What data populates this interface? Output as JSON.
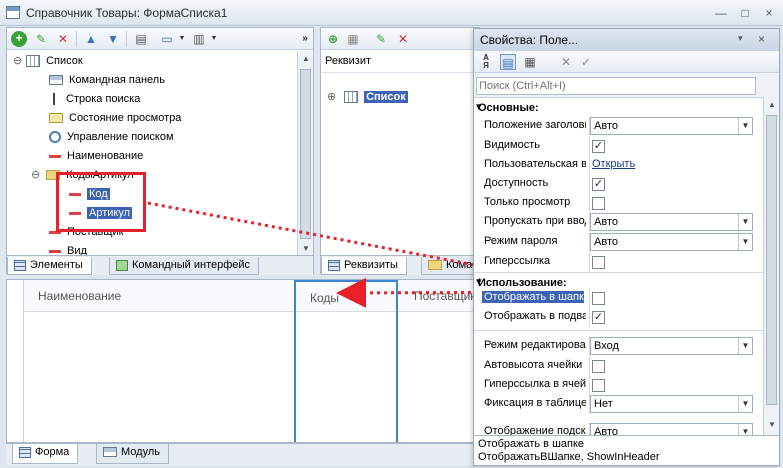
{
  "window": {
    "title": "Справочник Товары: ФормаСписка1",
    "minimize_glyph": "—",
    "maximize_glyph": "□",
    "close_glyph": "×"
  },
  "elements_tree": {
    "items": [
      {
        "label": "Список",
        "icon": "table-icon"
      },
      {
        "label": "Командная панель",
        "icon": "command-panel-icon"
      },
      {
        "label": "Строка поиска",
        "icon": "search-line-icon"
      },
      {
        "label": "Состояние просмотра",
        "icon": "view-state-icon"
      },
      {
        "label": "Управление поиском",
        "icon": "search-control-icon"
      },
      {
        "label": "Наименование",
        "icon": "field-icon"
      },
      {
        "label": "КодыАртикул",
        "icon": "folder-icon"
      },
      {
        "label": "Код",
        "icon": "field-icon"
      },
      {
        "label": "Артикул",
        "icon": "field-icon"
      },
      {
        "label": "Поставщик",
        "icon": "field-icon"
      },
      {
        "label": "Вид",
        "icon": "field-icon"
      }
    ]
  },
  "left_tabs": [
    "Элементы",
    "Командный интерфейс"
  ],
  "requisites": {
    "header": "Реквизит",
    "items": [
      {
        "label": "Список",
        "icon": "table-icon"
      }
    ],
    "tabs": [
      "Реквизиты",
      "Команды"
    ]
  },
  "preview": {
    "columns": [
      "Наименование",
      "Коды",
      "Поставщик"
    ]
  },
  "bottom_tabs": [
    "Форма",
    "Модуль"
  ],
  "properties": {
    "title": "Свойства: Поле...",
    "search_placeholder": "Поиск (Ctrl+Alt+I)",
    "sections": [
      "Основные:",
      "Использование:"
    ],
    "rows": [
      {
        "label": "Положение заголовка",
        "type": "combo",
        "value": "Авто"
      },
      {
        "label": "Видимость",
        "type": "check",
        "value": "✓"
      },
      {
        "label": "Пользовательская видимость",
        "type": "link",
        "value": "Открыть"
      },
      {
        "label": "Доступность",
        "type": "check",
        "value": "✓"
      },
      {
        "label": "Только просмотр",
        "type": "check",
        "value": ""
      },
      {
        "label": "Пропускать при вводе",
        "type": "combo",
        "value": "Авто"
      },
      {
        "label": "Режим пароля",
        "type": "combo",
        "value": "Авто"
      },
      {
        "label": "Гиперссылка",
        "type": "check",
        "value": ""
      },
      {
        "label": "Отображать в шапке",
        "type": "check",
        "value": ""
      },
      {
        "label": "Отображать в подвале",
        "type": "check",
        "value": "✓"
      },
      {
        "label": "Режим редактирования",
        "type": "combo",
        "value": "Вход"
      },
      {
        "label": "Автовысота ячейки",
        "type": "check",
        "value": ""
      },
      {
        "label": "Гиперссылка в ячейке",
        "type": "check",
        "value": ""
      },
      {
        "label": "Фиксация в таблице",
        "type": "combo",
        "value": "Нет"
      },
      {
        "label": "Отображение подсказки",
        "type": "combo",
        "value": "Авто"
      }
    ],
    "description_line1": "Отображать в шапке",
    "description_line2": "ОтображатьВШапке, ShowInHeader"
  },
  "colors": {
    "selection": "#3d63b5",
    "highlight_red": "#e8202a",
    "column_border": "#3a86d4"
  }
}
